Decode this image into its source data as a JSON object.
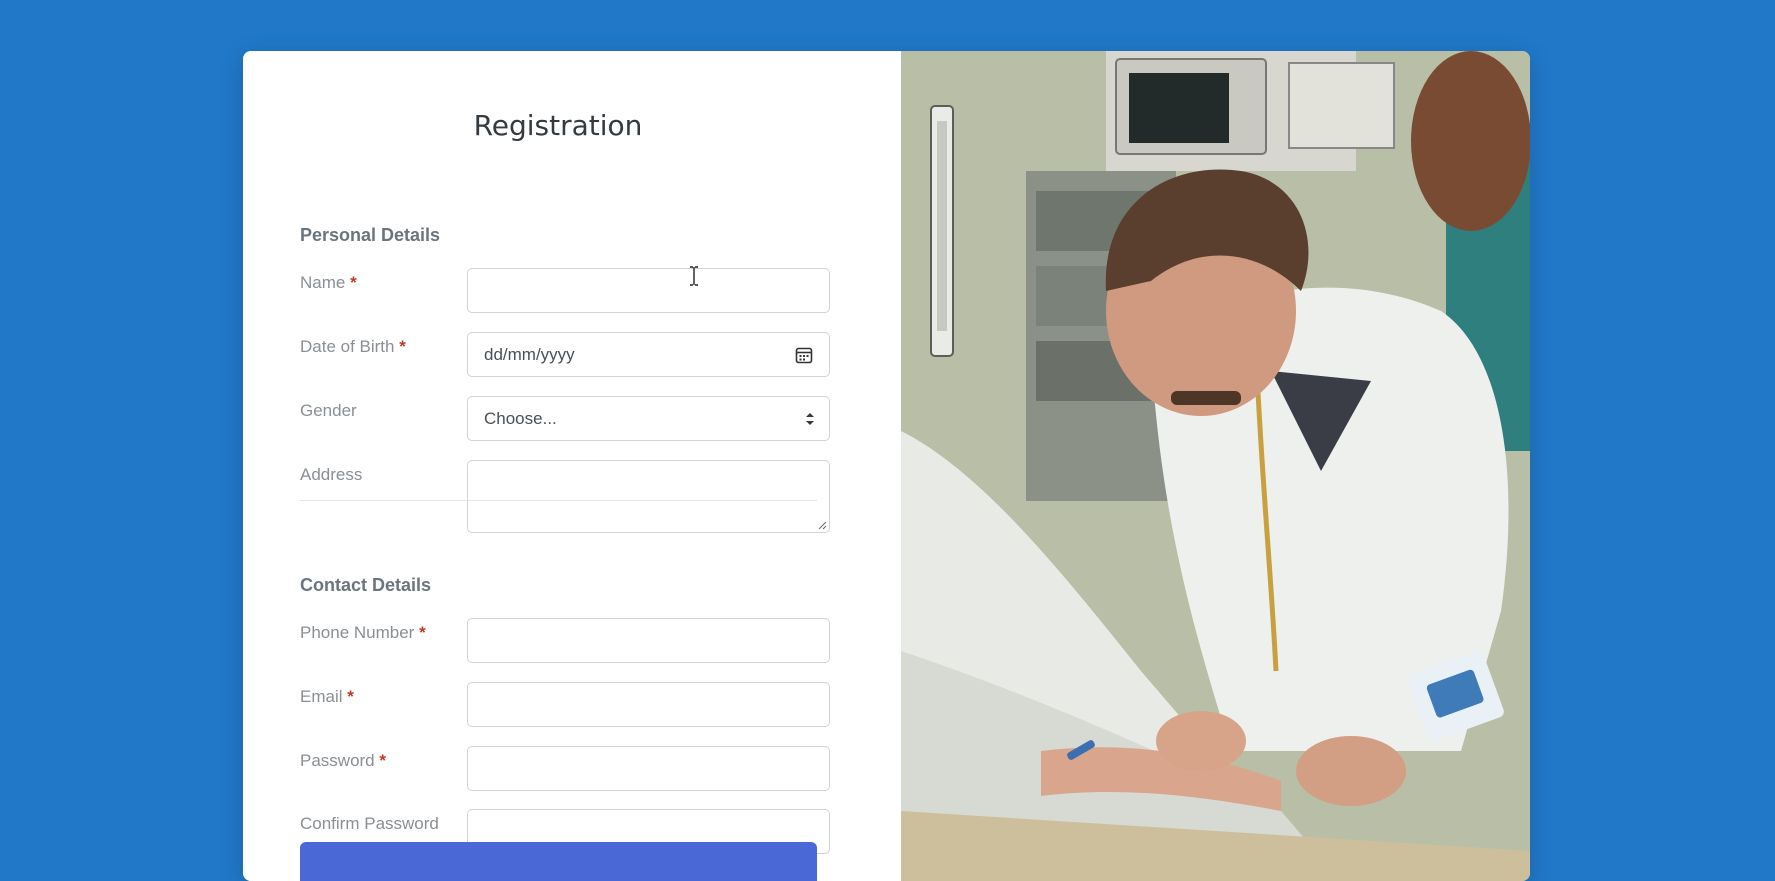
{
  "form": {
    "title": "Registration",
    "personal_section": "Personal Details",
    "contact_section": "Contact Details",
    "required_marker": "*",
    "fields": {
      "name": {
        "label": "Name",
        "value": ""
      },
      "dob": {
        "label": "Date of Birth",
        "placeholder": "dd/mm/yyyy"
      },
      "gender": {
        "label": "Gender",
        "selected": "Choose..."
      },
      "address": {
        "label": "Address",
        "value": ""
      },
      "phone": {
        "label": "Phone Number",
        "value": ""
      },
      "email": {
        "label": "Email",
        "value": ""
      },
      "password": {
        "label": "Password",
        "value": ""
      },
      "confirm_password": {
        "label": "Confirm Password",
        "value": ""
      }
    },
    "submit_label": ""
  },
  "icons": {
    "dob_icon": "calendar-icon",
    "gender_icon": "select-arrows-icon",
    "address_icon": "resize-grip-icon"
  },
  "colors": {
    "background": "#2178c9",
    "accent": "#4a68d6",
    "required": "#c0392b"
  }
}
